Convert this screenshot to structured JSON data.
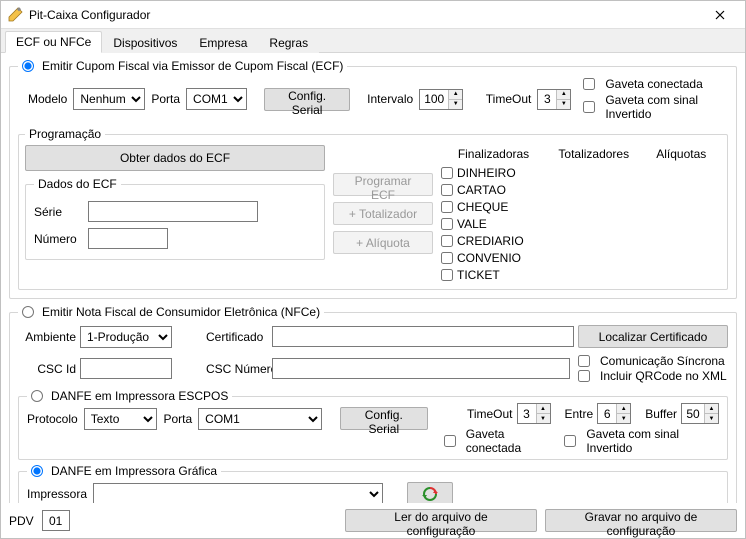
{
  "window": {
    "title": "Pit-Caixa Configurador"
  },
  "tabs": [
    "ECF ou NFCe",
    "Dispositivos",
    "Empresa",
    "Regras"
  ],
  "active_tab": 0,
  "ecf_section": {
    "radio_label": "Emitir Cupom Fiscal via Emissor de Cupom Fiscal (ECF)",
    "modelo_label": "Modelo",
    "modelo_value": "Nenhum",
    "porta_label": "Porta",
    "porta_value": "COM1",
    "config_serial": "Config. Serial",
    "intervalo_label": "Intervalo",
    "intervalo_value": "100",
    "timeout_label": "TimeOut",
    "timeout_value": "3",
    "gaveta_conectada": "Gaveta conectada",
    "gaveta_sinal": "Gaveta com sinal Invertido"
  },
  "programacao": {
    "legend": "Programação",
    "obter_dados": "Obter dados do ECF",
    "dados_do_ecf": "Dados do ECF",
    "serie_label": "Série",
    "serie_value": "",
    "numero_label": "Número",
    "numero_value": "",
    "btn_programar": "Programar ECF",
    "btn_totalizador": "+ Totalizador",
    "btn_aliquota": "+ Alíquota",
    "col_finalizadoras": "Finalizadoras",
    "col_totalizadores": "Totalizadores",
    "col_aliquotas": "Alíquotas",
    "finalizadoras": [
      "DINHEIRO",
      "CARTAO",
      "CHEQUE",
      "VALE",
      "CREDIARIO",
      "CONVENIO",
      "TICKET"
    ]
  },
  "nfce_section": {
    "radio_label": "Emitir Nota Fiscal de Consumidor Eletrônica (NFCe)",
    "ambiente_label": "Ambiente",
    "ambiente_value": "1-Produção",
    "certificado_label": "Certificado",
    "certificado_value": "",
    "localizar": "Localizar Certificado",
    "csc_id_label": "CSC Id",
    "csc_id_value": "",
    "csc_num_label": "CSC Número",
    "csc_num_value": "",
    "com_sincrona": "Comunicação Síncrona",
    "incluir_qrcode": "Incluir QRCode no XML"
  },
  "escpos": {
    "radio_label": "DANFE em Impressora ESCPOS",
    "protocolo_label": "Protocolo",
    "protocolo_value": "Texto",
    "porta_label": "Porta",
    "porta_value": "COM1",
    "config_serial": "Config. Serial",
    "timeout_label": "TimeOut",
    "timeout_value": "3",
    "entre_label": "Entre",
    "entre_value": "6",
    "buffer_label": "Buffer",
    "buffer_value": "50",
    "gaveta_conectada": "Gaveta conectada",
    "gaveta_sinal": "Gaveta com sinal Invertido"
  },
  "grafica": {
    "radio_label": "DANFE em Impressora Gráfica",
    "impressora_label": "Impressora",
    "impressora_value": ""
  },
  "footer": {
    "pdv_label": "PDV",
    "pdv_value": "01",
    "ler": "Ler do arquivo de configuração",
    "gravar": "Gravar no arquivo de configuração"
  }
}
